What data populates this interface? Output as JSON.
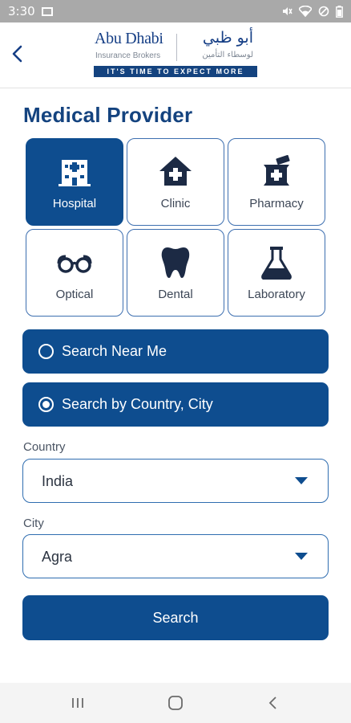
{
  "status_bar": {
    "time": "3:30",
    "icons": [
      "image-icon",
      "mute-icon",
      "wifi-icon",
      "dnd-icon",
      "battery-icon"
    ]
  },
  "header": {
    "logo": {
      "name_en": "Abu Dhabi",
      "sub_en": "Insurance Brokers",
      "name_ar": "أبو ظبي",
      "sub_ar": "لوسطاء التأمين",
      "tagline": "IT'S TIME TO EXPECT MORE"
    }
  },
  "page_title": "Medical Provider",
  "providers": [
    {
      "label": "Hospital",
      "icon": "hospital-icon",
      "selected": true
    },
    {
      "label": "Clinic",
      "icon": "clinic-icon",
      "selected": false
    },
    {
      "label": "Pharmacy",
      "icon": "pharmacy-icon",
      "selected": false
    },
    {
      "label": "Optical",
      "icon": "glasses-icon",
      "selected": false
    },
    {
      "label": "Dental",
      "icon": "tooth-icon",
      "selected": false
    },
    {
      "label": "Laboratory",
      "icon": "flask-icon",
      "selected": false
    }
  ],
  "search_options": {
    "near_me": {
      "label": "Search Near Me",
      "selected": false
    },
    "by_location": {
      "label": "Search by Country, City",
      "selected": true
    }
  },
  "country": {
    "label": "Country",
    "value": "India"
  },
  "city": {
    "label": "City",
    "value": "Agra"
  },
  "search_button": "Search",
  "colors": {
    "primary": "#0e4d8f",
    "title": "#14437f",
    "status_bar": "#a9a9a9"
  }
}
